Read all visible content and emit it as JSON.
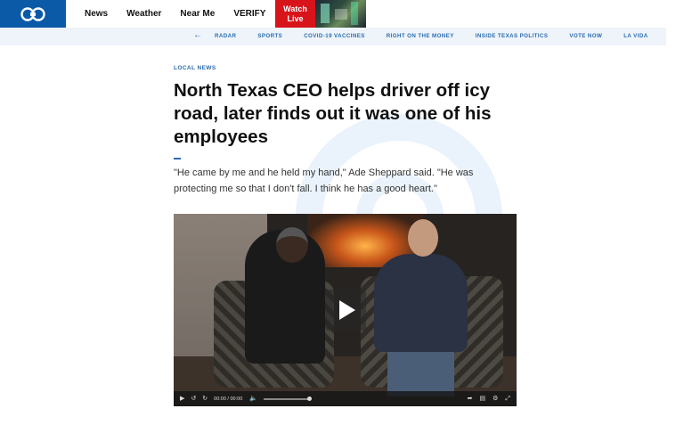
{
  "nav": {
    "logo_text": "WFAA 8",
    "items": [
      "News",
      "Weather",
      "Near Me",
      "VERIFY"
    ],
    "watch_live": "Watch Live"
  },
  "subnav": {
    "items": [
      "RADAR",
      "SPORTS",
      "COVID-19 VACCINES",
      "RIGHT ON THE MONEY",
      "INSIDE TEXAS POLITICS",
      "VOTE NOW",
      "LA VIDA"
    ]
  },
  "article": {
    "kicker": "LOCAL NEWS",
    "headline": "North Texas CEO helps driver off icy road, later finds out it was one of his employees",
    "summary": "\"He came by me and he held my hand,\" Ade Sheppard said. \"He was protecting me so that I don't fall. I think he has a good heart.\""
  },
  "video": {
    "time": "00:00 / 00:00",
    "volume": 1.0
  },
  "colors": {
    "brand": "#0a5aa8",
    "accent": "#2a6cb0",
    "live": "#d8141b"
  }
}
